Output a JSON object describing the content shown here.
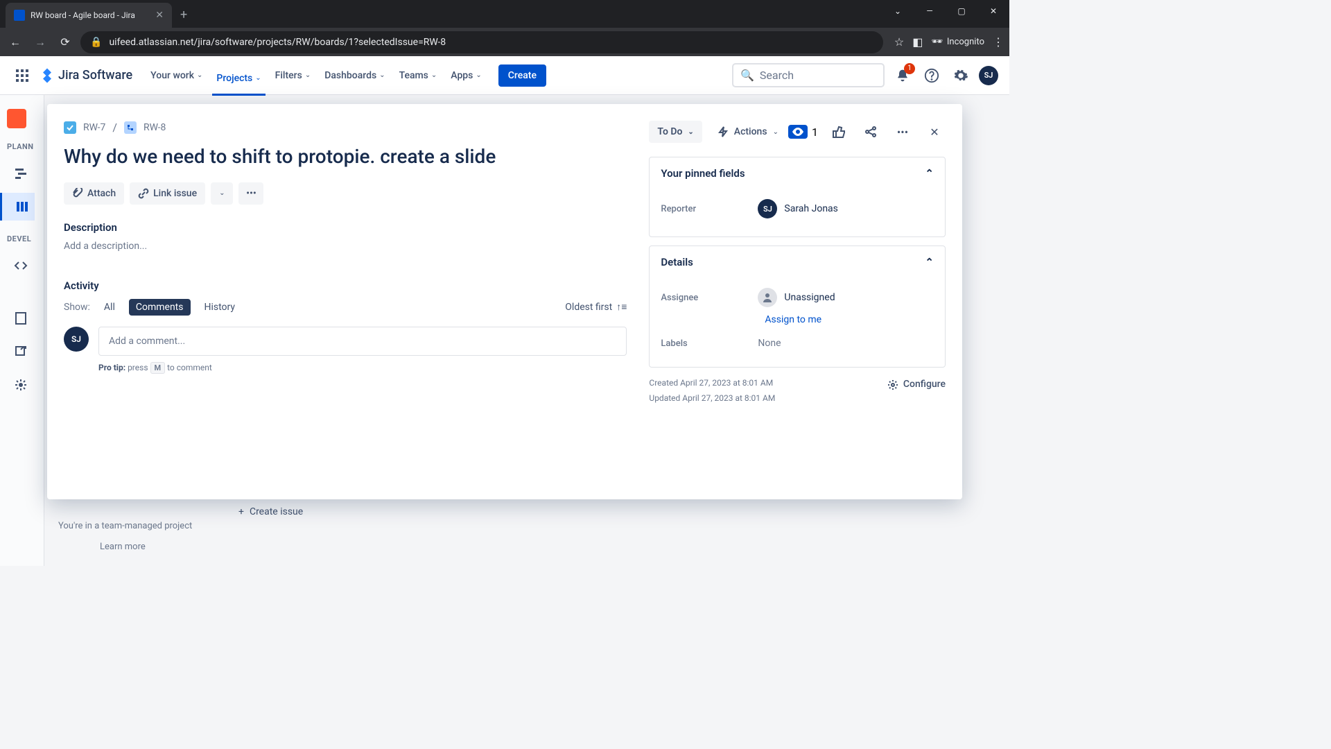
{
  "browser": {
    "tab_title": "RW board - Agile board - Jira",
    "url": "uifeed.atlassian.net/jira/software/projects/RW/boards/1?selectedIssue=RW-8",
    "incognito": "Incognito"
  },
  "nav": {
    "logo": "Jira Software",
    "items": {
      "your_work": "Your work",
      "projects": "Projects",
      "filters": "Filters",
      "dashboards": "Dashboards",
      "teams": "Teams",
      "apps": "Apps"
    },
    "create": "Create",
    "search_placeholder": "Search",
    "notif_count": "1",
    "avatar_initials": "SJ"
  },
  "sidebar": {
    "planning": "PLANN",
    "development": "DEVEL"
  },
  "breadcrumb": {
    "parent": "RW-7",
    "current": "RW-8"
  },
  "issue": {
    "title": "Why do we need to shift to protopie. create a slide",
    "watch_count": "1",
    "status": "To Do",
    "actions_label": "Actions",
    "attach": "Attach",
    "link_issue": "Link issue",
    "description_label": "Description",
    "description_placeholder": "Add a description...",
    "activity_label": "Activity",
    "show_label": "Show:",
    "filters": {
      "all": "All",
      "comments": "Comments",
      "history": "History"
    },
    "sort": "Oldest first",
    "comment_placeholder": "Add a comment...",
    "protip_prefix": "Pro tip:",
    "protip_press": "press",
    "protip_key": "M",
    "protip_suffix": "to comment",
    "commenter_initials": "SJ"
  },
  "panels": {
    "pinned_label": "Your pinned fields",
    "details_label": "Details",
    "reporter_label": "Reporter",
    "reporter_name": "Sarah Jonas",
    "reporter_initials": "SJ",
    "assignee_label": "Assignee",
    "assignee_value": "Unassigned",
    "assign_to_me": "Assign to me",
    "labels_label": "Labels",
    "labels_value": "None",
    "created": "Created April 27, 2023 at 8:01 AM",
    "updated": "Updated April 27, 2023 at 8:01 AM",
    "configure": "Configure"
  },
  "board_bg": {
    "create_issue": "Create issue",
    "footer": "You're in a team-managed project",
    "learn_more": "Learn more"
  }
}
